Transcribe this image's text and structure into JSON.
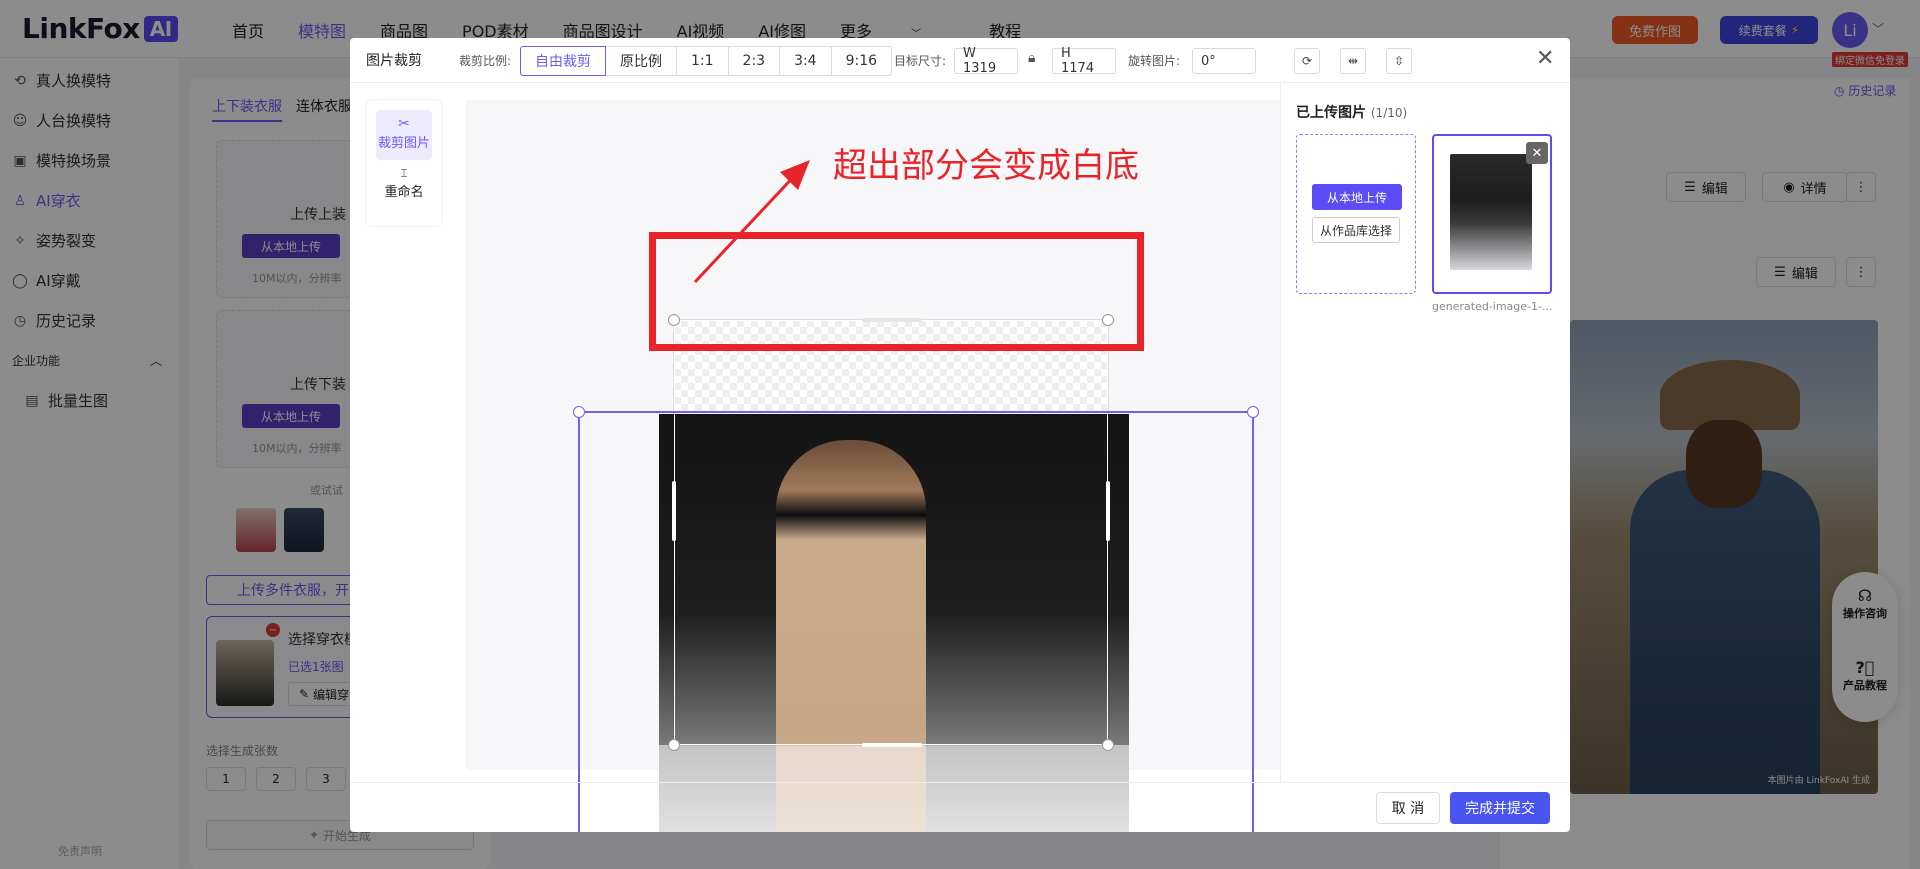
{
  "app": {
    "logo_text": "LinkFox",
    "logo_badge": "AI",
    "nav": [
      "首页",
      "模特图",
      "商品图",
      "POD素材",
      "商品图设计",
      "AI视频",
      "AI修图",
      "更多",
      "教程"
    ],
    "free_btn": "免费作图",
    "renew_btn": "续费套餐",
    "renew_icon": "⚡",
    "avatar": "Li",
    "avatar_badge": "绑定微信免登录",
    "accent": "#6a5cf5"
  },
  "sidebar": {
    "items": [
      {
        "label": "真人换模特",
        "icon": "person-swap-icon"
      },
      {
        "label": "人台换模特",
        "icon": "mannequin-icon"
      },
      {
        "label": "模特换场景",
        "icon": "scene-icon"
      },
      {
        "label": "AI穿衣",
        "icon": "shirt-icon"
      },
      {
        "label": "姿势裂变",
        "icon": "pose-icon"
      },
      {
        "label": "AI穿戴",
        "icon": "ring-icon"
      },
      {
        "label": "历史记录",
        "icon": "clock-icon"
      }
    ],
    "section": "企业功能",
    "sub_items": [
      {
        "label": "批量生图",
        "icon": "image-batch-icon"
      }
    ],
    "disclaimer": "免责声明"
  },
  "panel": {
    "tabs": [
      "上下装衣服",
      "连体衣服"
    ],
    "upload_top_title": "上传上装",
    "upload_bottom_title": "上传下装",
    "local_upload": "从本地上传",
    "tip": "10M以内，分辨率",
    "try_label": "或试试",
    "multi_btn": "上传多件衣服，开",
    "select_title": "选择穿衣模",
    "selected": "已选1张图",
    "edit": "编辑穿",
    "gen_label": "选择生成张数",
    "gen_options": [
      "1",
      "2",
      "3"
    ],
    "start": "开始生成"
  },
  "right": {
    "history": "历史记录",
    "edit": "编辑",
    "detail": "详情",
    "watermark": "本图片由 LinkFoxAI 生成",
    "consult": "操作咨询",
    "tutorial": "产品教程"
  },
  "modal": {
    "title": "图片裁剪",
    "ratio_label": "裁剪比例:",
    "ratios": [
      "自由裁剪",
      "原比例",
      "1:1",
      "2:3",
      "3:4",
      "9:16"
    ],
    "target_label": "目标尺寸:",
    "width": "W 1319",
    "height": "H 1174",
    "rotate_label": "旋转图片:",
    "rotate_value": "0°",
    "modes": [
      "裁剪图片",
      "重命名"
    ],
    "annotation": "超出部分会变成白底",
    "uploaded_title": "已上传图片",
    "uploaded_count": "(1/10)",
    "local_upload": "从本地上传",
    "library_select": "从作品库选择",
    "thumb_name": "generated-image-1-...",
    "cancel": "取 消",
    "submit": "完成并提交"
  }
}
